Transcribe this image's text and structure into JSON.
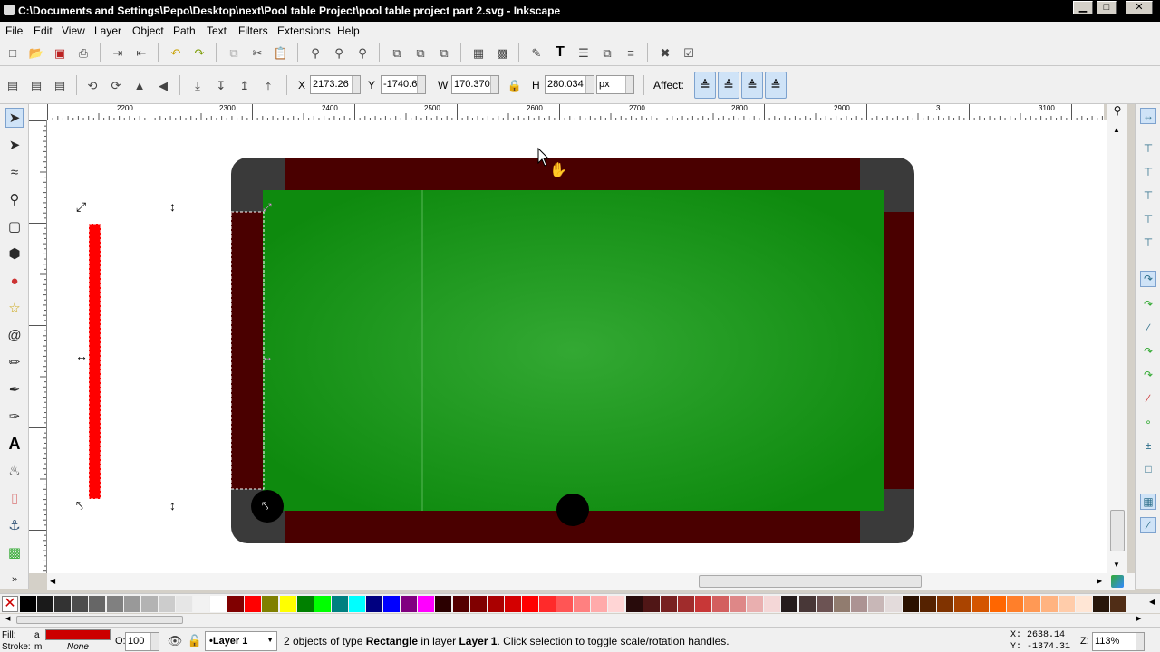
{
  "window": {
    "title": "C:\\Documents and Settings\\Pepo\\Desktop\\next\\Pool table Project\\pool table project part 2.svg - Inkscape",
    "minimize": "▁",
    "maximize": "□",
    "close": "✕"
  },
  "menu": [
    "File",
    "Edit",
    "View",
    "Layer",
    "Object",
    "Path",
    "Text",
    "Filters",
    "Extensions",
    "Help"
  ],
  "controls": {
    "x_label": "X",
    "x_value": "2173.26",
    "y_label": "Y",
    "y_value": "-1740.6",
    "w_label": "W",
    "w_value": "170.370",
    "h_label": "H",
    "h_value": "280.034",
    "unit": "px",
    "affect_label": "Affect:"
  },
  "ruler": {
    "h_labels": [
      "2200",
      "2300",
      "2400",
      "2500",
      "2600",
      "2700",
      "2800",
      "2900",
      "3",
      "3100"
    ],
    "v_labels": [
      "-1500",
      "-1600",
      "-1700",
      "-1800",
      "-1900"
    ]
  },
  "colors": {
    "felt_center": "#33a833",
    "felt_edge": "#0e8a0e",
    "rail": "#4a0000",
    "pocket_corner": "#3a3a3a",
    "ball": "#000000",
    "red_rect": "#ff0000",
    "fill_swatch": "#cc0000",
    "accent": "#3574b8"
  },
  "palette": [
    "#000000",
    "#1a1a1a",
    "#333333",
    "#4d4d4d",
    "#666666",
    "#808080",
    "#999999",
    "#b3b3b3",
    "#cccccc",
    "#e6e6e6",
    "#f2f2f2",
    "#ffffff",
    "#800000",
    "#ff0000",
    "#808000",
    "#ffff00",
    "#008000",
    "#00ff00",
    "#008080",
    "#00ffff",
    "#000080",
    "#0000ff",
    "#800080",
    "#ff00ff",
    "#2b0000",
    "#550000",
    "#800000",
    "#aa0000",
    "#d40000",
    "#ff0000",
    "#ff2a2a",
    "#ff5555",
    "#ff8080",
    "#ffaaaa",
    "#ffd5d5",
    "#280b0b",
    "#501616",
    "#782121",
    "#a02c2c",
    "#c83737",
    "#d35f5f",
    "#de8787",
    "#e9afaf",
    "#f4d7d7",
    "#241c1c",
    "#483737",
    "#6c5353",
    "#917c6f",
    "#ac9393",
    "#c8b7b7",
    "#e3dbdb",
    "#2b1100",
    "#552200",
    "#803300",
    "#aa4400",
    "#d45500",
    "#ff6600",
    "#ff7f2a",
    "#ff9955",
    "#ffb380",
    "#ffccaa",
    "#ffe6d5",
    "#28170b",
    "#502d16"
  ],
  "status": {
    "fill_label": "Fill:",
    "fill_value": "a",
    "stroke_label": "Stroke:",
    "stroke_value": "m",
    "stroke_none": "None",
    "opacity_label": "O:",
    "opacity_value": "100",
    "layer_name": "•Layer 1",
    "message_prefix": "2 objects of type ",
    "message_type": "Rectangle",
    "message_mid": " in layer ",
    "message_layer": "Layer 1",
    "message_suffix": ". Click selection to toggle scale/rotation handles.",
    "cursor_x": "X:  2638.14",
    "cursor_y": "Y: -1374.31",
    "zoom_label": "Z:",
    "zoom_value": "113%"
  }
}
